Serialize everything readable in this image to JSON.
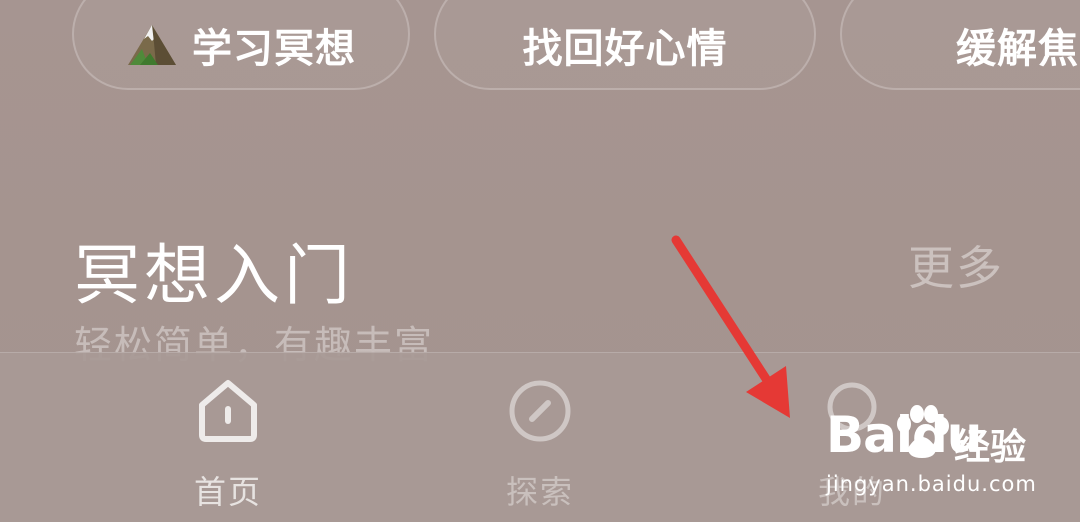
{
  "chips": [
    {
      "label": "学习冥想",
      "icon": "mountain-icon"
    },
    {
      "label": "找回好心情"
    },
    {
      "label": "缓解焦"
    }
  ],
  "section": {
    "title": "冥想入门",
    "more_label": "更多",
    "subtitle": "轻松简单，有趣丰富"
  },
  "tabbar": {
    "items": [
      {
        "label": "首页",
        "icon": "home-icon",
        "active": true
      },
      {
        "label": "探索",
        "icon": "compass-icon",
        "active": false
      },
      {
        "label": "我的",
        "icon": "profile-icon",
        "active": false
      }
    ]
  },
  "annotation": {
    "arrow_color": "#e53935"
  },
  "watermark": {
    "brand": "Baidu",
    "text": "经验",
    "url": "jingyan.baidu.com"
  },
  "colors": {
    "background": "#a5948f",
    "text": "#ffffff"
  }
}
